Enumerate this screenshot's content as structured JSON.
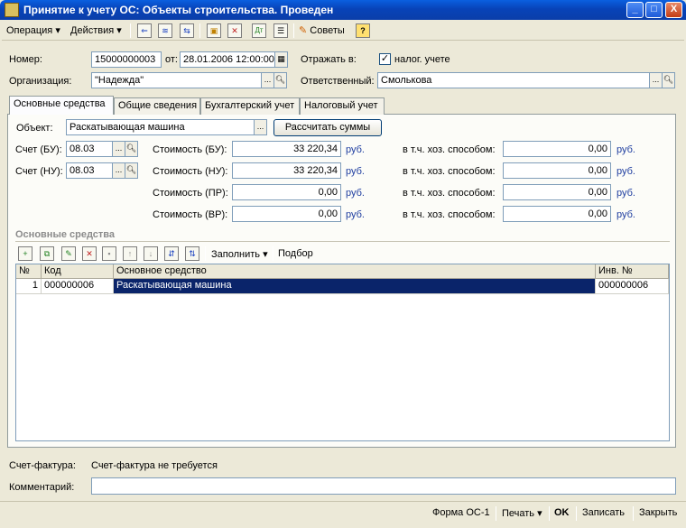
{
  "window": {
    "title": "Принятие к учету ОС: Объекты строительства. Проведен",
    "minimize": "_",
    "maximize": "□",
    "close": "X"
  },
  "toolbar": {
    "operation": "Операция",
    "actions": "Действия",
    "tips": "Советы",
    "help": "?"
  },
  "header": {
    "number_label": "Номер:",
    "number_value": "15000000003",
    "from_label": "от:",
    "date_value": "28.01.2006 12:00:00",
    "reflect_label": "Отражать в:",
    "tax_label": "налог. учете",
    "tax_checked": "✓",
    "org_label": "Организация:",
    "org_value": "\"Надежда\"",
    "resp_label": "Ответственный:",
    "resp_value": "Смолькова",
    "ellipsis": "...",
    "search_icon": "search-icon"
  },
  "tabs": [
    {
      "label": "Основные средства"
    },
    {
      "label": "Общие сведения"
    },
    {
      "label": "Бухгалтерский учет"
    },
    {
      "label": "Налоговый учет"
    }
  ],
  "main": {
    "object_label": "Объект:",
    "object_value": "Раскатывающая машина",
    "calc_button": "Рассчитать суммы",
    "acc_bu_label": "Счет (БУ):",
    "acc_bu_value": "08.03",
    "acc_nu_label": "Счет (НУ):",
    "acc_nu_value": "08.03",
    "costs": [
      {
        "label": "Стоимость (БУ):",
        "value": "33 220,34",
        "unit": "руб.",
        "hh_label": "в т.ч. хоз. способом:",
        "hh_value": "0,00",
        "hh_unit": "руб."
      },
      {
        "label": "Стоимость (НУ):",
        "value": "33 220,34",
        "unit": "руб.",
        "hh_label": "в т.ч. хоз. способом:",
        "hh_value": "0,00",
        "hh_unit": "руб."
      },
      {
        "label": "Стоимость (ПР):",
        "value": "0,00",
        "unit": "руб.",
        "hh_label": "в т.ч. хоз. способом:",
        "hh_value": "0,00",
        "hh_unit": "руб."
      },
      {
        "label": "Стоимость (ВР):",
        "value": "0,00",
        "unit": "руб.",
        "hh_label": "в т.ч. хоз. способом:",
        "hh_value": "0,00",
        "hh_unit": "руб."
      }
    ],
    "section_title": "Основные средства",
    "fill_button": "Заполнить",
    "pick_button": "Подбор"
  },
  "grid": {
    "columns": [
      "№",
      "Код",
      "Основное средство",
      "Инв. №"
    ],
    "rows": [
      [
        "1",
        "000000006",
        "Раскатывающая машина",
        "000000006"
      ]
    ]
  },
  "footer": {
    "invoice_label": "Счет-фактура:",
    "invoice_value": "Счет-фактура не требуется",
    "comment_label": "Комментарий:",
    "comment_value": ""
  },
  "statusbar": {
    "form": "Форма ОС-1",
    "print": "Печать",
    "ok": "OK",
    "save": "Записать",
    "close": "Закрыть"
  }
}
